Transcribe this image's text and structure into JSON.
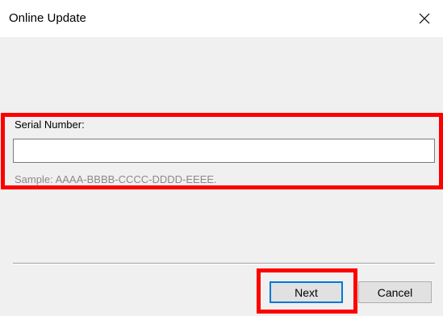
{
  "window": {
    "title": "Online Update"
  },
  "form": {
    "serial_label": "Serial Number:",
    "serial_value": "",
    "sample_text": "Sample: AAAA-BBBB-CCCC-DDDD-EEEE."
  },
  "buttons": {
    "next_label": "Next",
    "cancel_label": "Cancel"
  },
  "icons": {
    "close": "close-icon"
  },
  "colors": {
    "highlight": "#ff0000",
    "focus": "#0078d7"
  }
}
